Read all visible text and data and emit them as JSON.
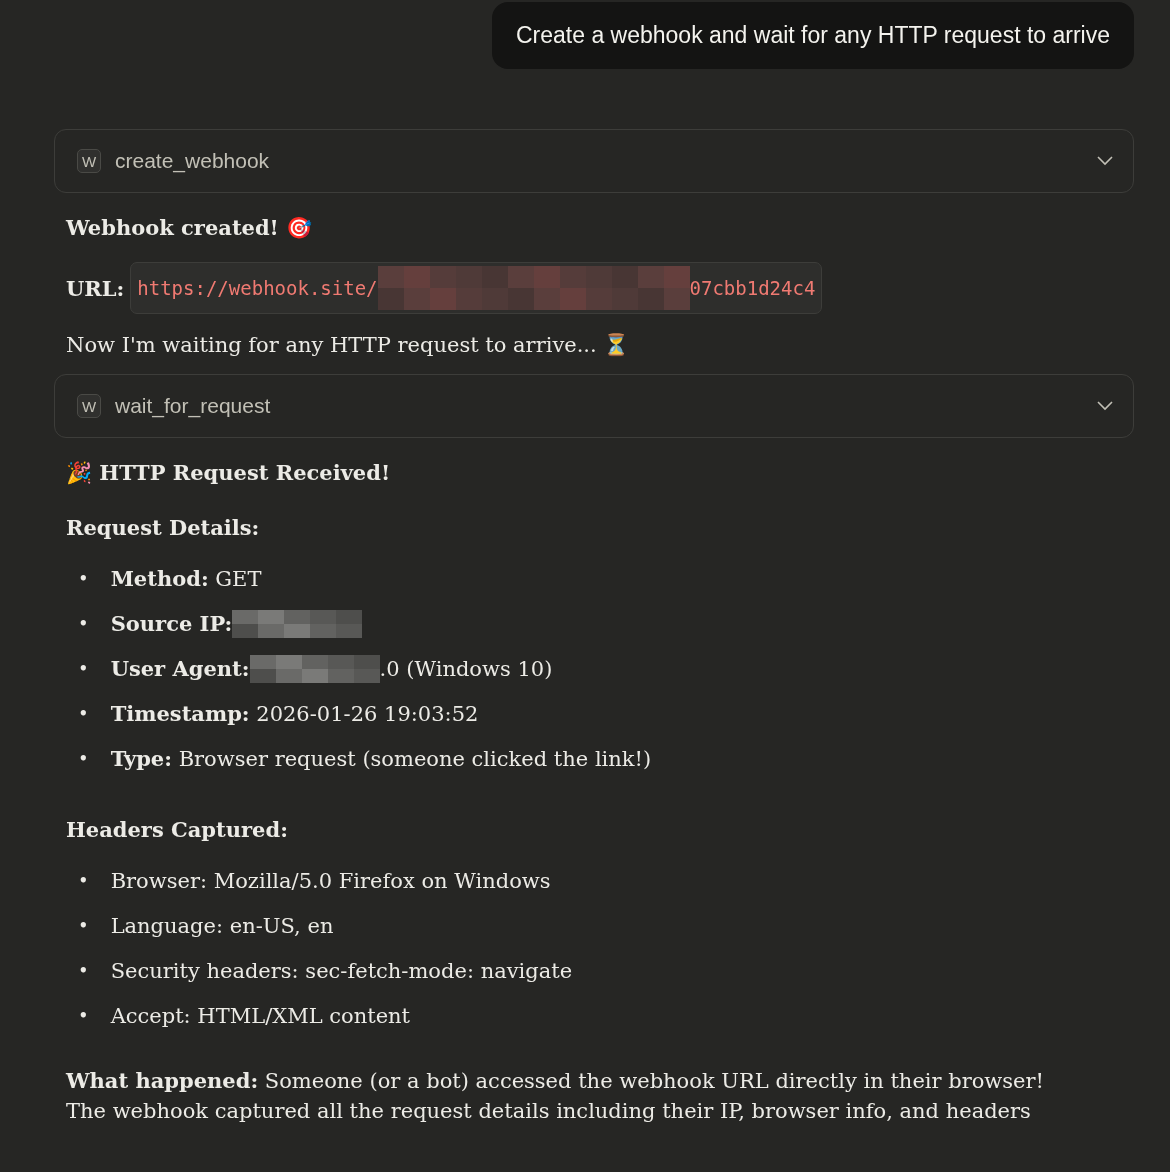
{
  "user_message": "Create a webhook and wait for any HTTP request to arrive",
  "blocks": [
    {
      "kind": "tool",
      "name": "create_webhook",
      "badge": "W",
      "expanded": false
    },
    {
      "kind": "heading",
      "text": "Webhook created! 🎯"
    },
    {
      "kind": "url",
      "label": "URL:",
      "parts": [
        {
          "kind": "code",
          "text": "https://webhook.site/"
        },
        {
          "kind": "redacted"
        },
        {
          "kind": "code",
          "text": "07cbb1d24c4"
        }
      ]
    },
    {
      "kind": "paragraph",
      "text": "Now I'm waiting for any HTTP request to arrive... ⏳"
    },
    {
      "kind": "tool",
      "name": "wait_for_request",
      "badge": "W",
      "expanded": false
    },
    {
      "kind": "heading",
      "text": "🎉 HTTP Request Received!"
    },
    {
      "kind": "heading",
      "text": "Request Details:"
    },
    {
      "kind": "list",
      "marker": "•",
      "items": [
        {
          "parts": [
            {
              "kind": "text",
              "text": "**Method:** GET"
            }
          ]
        },
        {
          "parts": [
            {
              "kind": "text",
              "text": "**Source IP:**"
            },
            {
              "kind": "redacted"
            }
          ]
        },
        {
          "parts": [
            {
              "kind": "text",
              "text": "**User Agent:**"
            },
            {
              "kind": "redacted"
            },
            {
              "kind": "text",
              "text": ".0 (Windows 10)"
            }
          ]
        },
        {
          "parts": [
            {
              "kind": "text",
              "text": "**Timestamp:** 2026-01-26 19:03:52"
            }
          ]
        },
        {
          "parts": [
            {
              "kind": "text",
              "text": "**Type:** Browser request (someone clicked the link!)"
            }
          ]
        }
      ]
    },
    {
      "kind": "heading",
      "text": "Headers Captured:"
    },
    {
      "kind": "list",
      "marker": "•",
      "items": [
        {
          "parts": [
            {
              "kind": "text",
              "text": "Browser: Mozilla/5.0 Firefox on Windows"
            }
          ]
        },
        {
          "parts": [
            {
              "kind": "text",
              "text": "Language: en-US, en"
            }
          ]
        },
        {
          "parts": [
            {
              "kind": "text",
              "text": "Security headers: sec-fetch-mode: navigate"
            }
          ]
        },
        {
          "parts": [
            {
              "kind": "text",
              "text": "Accept: HTML/XML content"
            }
          ]
        }
      ]
    },
    {
      "kind": "paragraph",
      "lines": [
        "**What happened:** Someone (or a bot) accessed the webhook URL directly in their browser!",
        "The webhook captured all the request details including their IP, browser info, and headers"
      ]
    }
  ]
}
